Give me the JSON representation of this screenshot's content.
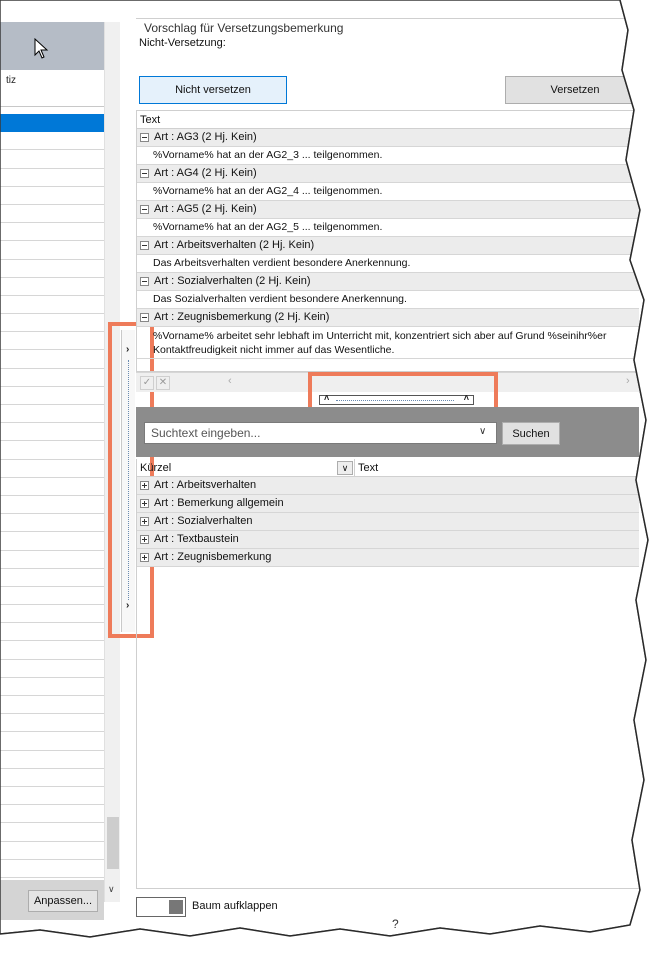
{
  "left_panel": {
    "column_partial_label": "tiz",
    "anpassen_label": "Anpassen..."
  },
  "vorschlag": {
    "title": "Vorschlag für Versetzungsbemerkung",
    "nicht_versetzung_label": "Nicht-Versetzung:",
    "nicht_versetzen_label": "Nicht versetzen",
    "versetzen_label": "Versetzen"
  },
  "grid": {
    "header": "Text",
    "groups": [
      {
        "label": "Art : AG3 (2 Hj. Kein)",
        "text": "%Vorname% hat an der AG2_3 ... teilgenommen."
      },
      {
        "label": "Art : AG4 (2 Hj. Kein)",
        "text": "%Vorname% hat an der AG2_4 ... teilgenommen."
      },
      {
        "label": "Art : AG5 (2 Hj. Kein)",
        "text": "%Vorname% hat an der AG2_5 ... teilgenommen."
      },
      {
        "label": "Art : Arbeitsverhalten (2 Hj. Kein)",
        "text": "Das Arbeitsverhalten verdient besondere Anerkennung."
      },
      {
        "label": "Art : Sozialverhalten (2 Hj. Kein)",
        "text": "Das Sozialverhalten verdient besondere Anerkennung."
      },
      {
        "label": "Art : Zeugnisbemerkung (2 Hj. Kein)",
        "text": "%Vorname% arbeitet sehr lebhaft im Unterricht mit, konzentriert sich aber auf Grund %seinihr%er Kontaktfreudigkeit nicht immer auf das Wesentliche."
      }
    ]
  },
  "search": {
    "placeholder": "Suchtext eingeben...",
    "button_label": "Suchen"
  },
  "lower_grid": {
    "col_kuerzel": "Kürzel",
    "col_text": "Text",
    "groups": [
      "Art : Arbeitsverhalten",
      "Art : Bemerkung allgemein",
      "Art : Sozialverhalten",
      "Art : Textbaustein",
      "Art : Zeugnisbemerkung"
    ]
  },
  "bottom": {
    "baum_label": "Baum aufklappen",
    "help_glyph": "?"
  },
  "colors": {
    "highlight": "#ee7b5a",
    "selection": "#0078d7",
    "search_bar_bg": "#8c8c8c"
  }
}
